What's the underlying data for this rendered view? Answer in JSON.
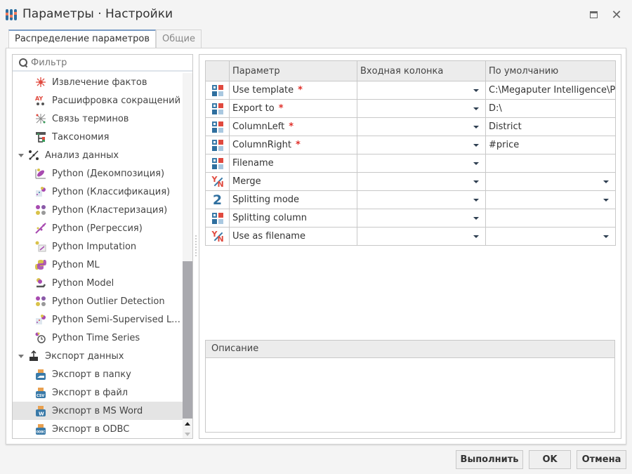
{
  "window": {
    "title": "Параметры · Настройки",
    "maximize_label": "",
    "close_glyph": "✕"
  },
  "tabs": [
    {
      "label": "Распределение параметров",
      "active": true
    },
    {
      "label": "Общие",
      "active": false
    }
  ],
  "filter": {
    "placeholder": "Фильтр",
    "value": ""
  },
  "tree": {
    "items": [
      {
        "label": "Извлечение фактов",
        "level": 2,
        "icon": "fact-extraction-icon"
      },
      {
        "label": "Расшифровка сокращений",
        "level": 2,
        "icon": "abbreviation-icon"
      },
      {
        "label": "Связь терминов",
        "level": 2,
        "icon": "term-link-icon"
      },
      {
        "label": "Таксономия",
        "level": 2,
        "icon": "taxonomy-icon"
      },
      {
        "label": "Анализ данных",
        "level": 1,
        "icon": "data-analysis-icon",
        "expanded": true
      },
      {
        "label": "Python (Декомпозиция)",
        "level": 2,
        "icon": "python-decomposition-icon"
      },
      {
        "label": "Python (Классификация)",
        "level": 2,
        "icon": "python-classification-icon"
      },
      {
        "label": "Python (Кластеризация)",
        "level": 2,
        "icon": "python-clustering-icon"
      },
      {
        "label": "Python (Регрессия)",
        "level": 2,
        "icon": "python-regression-icon"
      },
      {
        "label": "Python Imputation",
        "level": 2,
        "icon": "python-imputation-icon"
      },
      {
        "label": "Python ML",
        "level": 2,
        "icon": "python-ml-icon"
      },
      {
        "label": "Python Model",
        "level": 2,
        "icon": "python-model-icon"
      },
      {
        "label": "Python Outlier Detection",
        "level": 2,
        "icon": "python-outlier-icon"
      },
      {
        "label": "Python Semi-Supervised Le...",
        "level": 2,
        "icon": "python-semi-supervised-icon"
      },
      {
        "label": "Python Time Series",
        "level": 2,
        "icon": "python-time-series-icon"
      },
      {
        "label": "Экспорт данных",
        "level": 1,
        "icon": "data-export-icon",
        "expanded": true
      },
      {
        "label": "Экспорт в папку",
        "level": 2,
        "icon": "export-folder-icon"
      },
      {
        "label": "Экспорт в файл",
        "level": 2,
        "icon": "export-csv-icon"
      },
      {
        "label": "Экспорт в MS Word",
        "level": 2,
        "icon": "export-word-icon",
        "selected": true
      },
      {
        "label": "Экспорт в ODBC",
        "level": 2,
        "icon": "export-odbc-icon"
      }
    ]
  },
  "grid": {
    "columns": [
      "Параметр",
      "Входная колонка",
      "По умолчанию"
    ],
    "rows": [
      {
        "type": "column-type-icon",
        "name": "Use template",
        "required": true,
        "input": "",
        "default": "C:\\Megaputer Intelligence\\Po",
        "default_dropdown": false
      },
      {
        "type": "column-type-icon",
        "name": "Export to",
        "required": true,
        "input": "",
        "default": "D:\\",
        "default_dropdown": false
      },
      {
        "type": "column-type-icon",
        "name": "ColumnLeft",
        "required": true,
        "input": "",
        "default": "District",
        "default_dropdown": false
      },
      {
        "type": "column-type-icon",
        "name": "ColumnRight",
        "required": true,
        "input": "",
        "default": "#price",
        "default_dropdown": false
      },
      {
        "type": "column-type-icon",
        "name": "Filename",
        "required": false,
        "input": "",
        "default": "",
        "default_dropdown": false
      },
      {
        "type": "boolean-type-icon",
        "name": "Merge",
        "required": false,
        "input": "",
        "default": "",
        "default_dropdown": true
      },
      {
        "type": "integer-type-icon",
        "name": "Splitting mode",
        "required": false,
        "input": "",
        "default": "",
        "default_dropdown": true
      },
      {
        "type": "column-type-icon",
        "name": "Splitting column",
        "required": false,
        "input": "",
        "default": "",
        "default_dropdown": false
      },
      {
        "type": "boolean-type-icon",
        "name": "Use as filename",
        "required": false,
        "input": "",
        "default": "",
        "default_dropdown": true
      }
    ],
    "required_mark": "*",
    "integer_glyph": "2",
    "bool_y": "Y",
    "bool_n": "N"
  },
  "description": {
    "header": "Описание",
    "text": ""
  },
  "buttons": {
    "run": "Выполнить",
    "ok": "OK",
    "cancel": "Отмена"
  }
}
